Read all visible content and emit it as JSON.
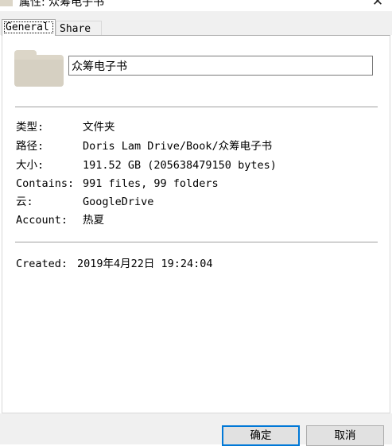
{
  "window": {
    "title": "属性: 众筹电子书",
    "close_glyph": "✕"
  },
  "tabs": [
    {
      "label": "General",
      "active": true
    },
    {
      "label": "Share",
      "active": false
    }
  ],
  "general": {
    "name_value": "众筹电子书",
    "properties": [
      {
        "label": "类型:",
        "value": "文件夹"
      },
      {
        "label": "路径:",
        "value": "Doris Lam Drive/Book/众筹电子书"
      },
      {
        "label": "大小:",
        "value": "191.52 GB (205638479150 bytes)"
      },
      {
        "label": "Contains:",
        "value": "991 files, 99 folders"
      },
      {
        "label": "云:",
        "value": "GoogleDrive"
      },
      {
        "label": "Account:",
        "value": "热夏"
      }
    ],
    "created_label": "Created:",
    "created_value": "2019年4月22日 19:24:04"
  },
  "buttons": {
    "ok_label": "确定",
    "cancel_label": "取消"
  },
  "colors": {
    "folder": "#dcd6c8",
    "focus_border": "#0078d7",
    "footer_bg": "#f0f0f0"
  },
  "icons": {
    "title_icon": "folder-icon",
    "main_icon": "folder-icon",
    "close": "close-icon"
  }
}
